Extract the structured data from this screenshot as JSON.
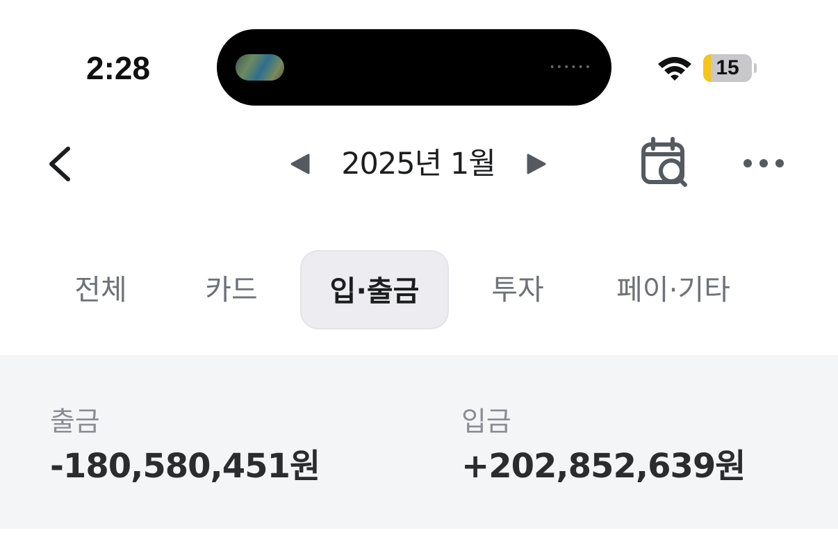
{
  "status_bar": {
    "time": "2:28",
    "battery_level": "15",
    "island_dots": "••••••"
  },
  "nav": {
    "month_title": "2025년 1월",
    "icons": {
      "back": "chevron-left-icon",
      "prev": "triangle-left-icon",
      "next": "triangle-right-icon",
      "calendar_search": "calendar-search-icon",
      "more": "more-horizontal-icon"
    }
  },
  "tabs": [
    {
      "label": "전체",
      "active": false
    },
    {
      "label": "카드",
      "active": false
    },
    {
      "label": "입·출금",
      "active": true
    },
    {
      "label": "투자",
      "active": false
    },
    {
      "label": "페이·기타",
      "active": false
    }
  ],
  "summary": {
    "outgoing_label": "출금",
    "outgoing_value": "-180,580,451원",
    "incoming_label": "입금",
    "incoming_value": "+202,852,639원"
  },
  "colors": {
    "active_tab_bg": "#ededf1",
    "summary_bg": "#f4f5f7",
    "battery_fill": "#f5c518",
    "icon_gray": "#555a60"
  }
}
